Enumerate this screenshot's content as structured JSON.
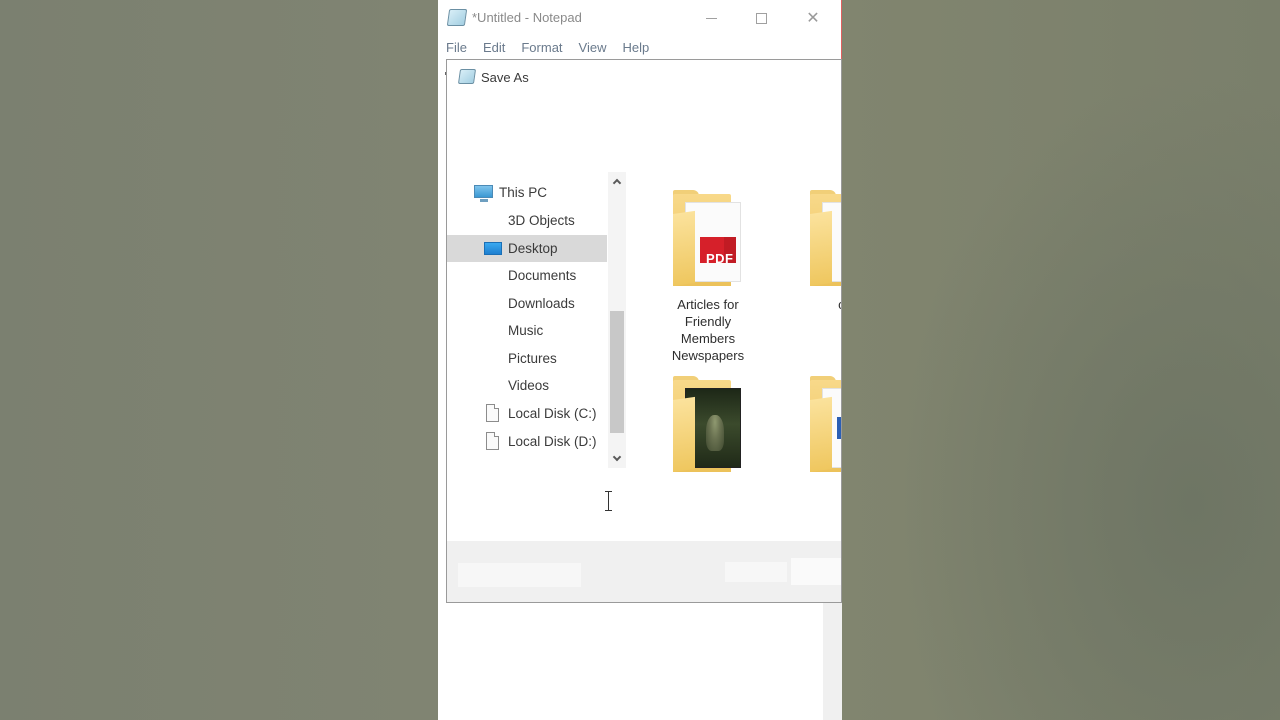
{
  "notepad": {
    "title": "*Untitled - Notepad",
    "menu": [
      "File",
      "Edit",
      "Format",
      "View",
      "Help"
    ],
    "window_buttons": {
      "minimize_icon": "minimize-icon",
      "maximize_icon": "maximize-icon",
      "close_glyph": "✕"
    }
  },
  "save_dialog": {
    "title": "Save As",
    "nav_items": [
      {
        "label": "This PC",
        "icon": "pc-icon"
      },
      {
        "label": "3D Objects",
        "icon": ""
      },
      {
        "label": "Desktop",
        "icon": "desktop-icon",
        "selected": true
      },
      {
        "label": "Documents",
        "icon": ""
      },
      {
        "label": "Downloads",
        "icon": ""
      },
      {
        "label": "Music",
        "icon": ""
      },
      {
        "label": "Pictures",
        "icon": ""
      },
      {
        "label": "Videos",
        "icon": ""
      },
      {
        "label": "Local Disk (C:)",
        "icon": "disk-icon"
      },
      {
        "label": "Local Disk (D:)",
        "icon": "disk-icon"
      }
    ],
    "folders": [
      {
        "label": "Articles for Friendly Members Newspapers",
        "thumb": "pdf",
        "pdf_text": "PDF"
      },
      {
        "label": "co",
        "thumb": "paper"
      },
      {
        "label": "",
        "thumb": "photo"
      },
      {
        "label": "",
        "thumb": "word"
      }
    ]
  },
  "colors": {
    "selected_nav": "#d9d9d9",
    "folder_yellow": "#ecc25a",
    "pdf_red": "#d6202a"
  }
}
